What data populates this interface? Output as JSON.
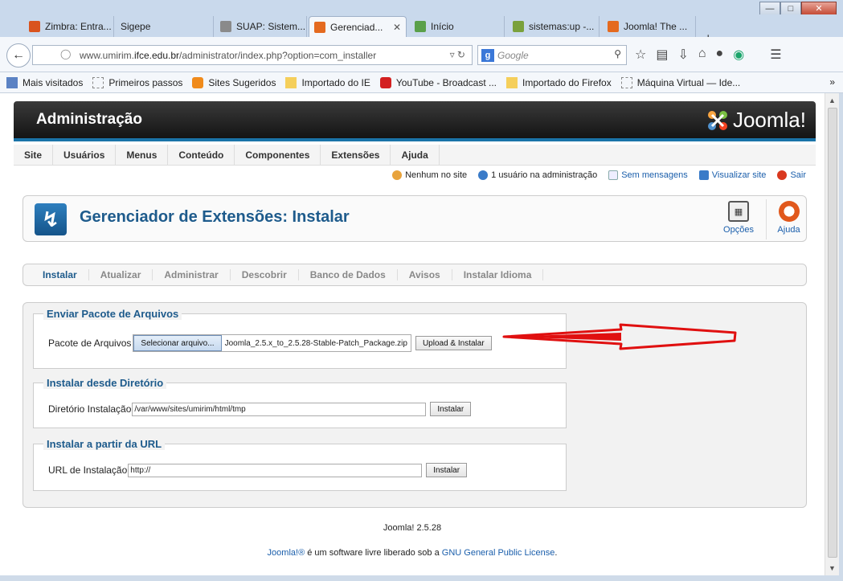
{
  "browser": {
    "tabs": [
      {
        "label": "Zimbra: Entra...",
        "color": "#d9531e"
      },
      {
        "label": "Sigepe",
        "color": ""
      },
      {
        "label": "SUAP: Sistem...",
        "color": "#8a8a8a"
      },
      {
        "label": "Gerenciad...",
        "color": "#e46a1f"
      },
      {
        "label": "Início",
        "color": "#5aa04a"
      },
      {
        "label": "sistemas:up -...",
        "color": "#7aa13c"
      },
      {
        "label": "Joomla! The ...",
        "color": "#e46a1f"
      }
    ],
    "url_prefix": "www.umirim.",
    "url_domain": "ifce.edu.br",
    "url_path": "/administrator/index.php?option=com_installer",
    "search_placeholder": "Google",
    "bookmarks": [
      "Mais visitados",
      "Primeiros passos",
      "Sites Sugeridos",
      "Importado do IE",
      "YouTube - Broadcast ...",
      "Importado do Firefox",
      "Máquina Virtual — Ide..."
    ],
    "bookmarks_more": "»"
  },
  "admin": {
    "header_title": "Administração",
    "logo_text": "Joomla!",
    "menu": [
      "Site",
      "Usuários",
      "Menus",
      "Conteúdo",
      "Componentes",
      "Extensões",
      "Ajuda"
    ],
    "status": {
      "visitors": "Nenhum no site",
      "admins": "1 usuário na administração",
      "messages": "Sem mensagens",
      "view_site": "Visualizar site",
      "logout": "Sair"
    },
    "page_title": "Gerenciador de Extensões: Instalar",
    "toolbar": {
      "options": "Opções",
      "help": "Ajuda"
    },
    "subnav": [
      "Instalar",
      "Atualizar",
      "Administrar",
      "Descobrir",
      "Banco de Dados",
      "Avisos",
      "Instalar Idioma"
    ],
    "upload": {
      "legend": "Enviar Pacote de Arquivos",
      "label": "Pacote de Arquivos",
      "file_button": "Selecionar arquivo...",
      "file_name": "Joomla_2.5.x_to_2.5.28-Stable-Patch_Package.zip",
      "submit": "Upload & Instalar"
    },
    "directory": {
      "legend": "Instalar desde Diretório",
      "label": "Diretório Instalação",
      "value": "/var/www/sites/umirim/html/tmp",
      "submit": "Instalar"
    },
    "url": {
      "legend": "Instalar a partir da URL",
      "label": "URL de Instalação",
      "value": "http://",
      "submit": "Instalar"
    },
    "version": "Joomla! 2.5.28",
    "footer": {
      "joomla_link": "Joomla!®",
      "text": " é um software livre liberado sob a ",
      "license_link": "GNU General Public License",
      "end": "."
    }
  }
}
